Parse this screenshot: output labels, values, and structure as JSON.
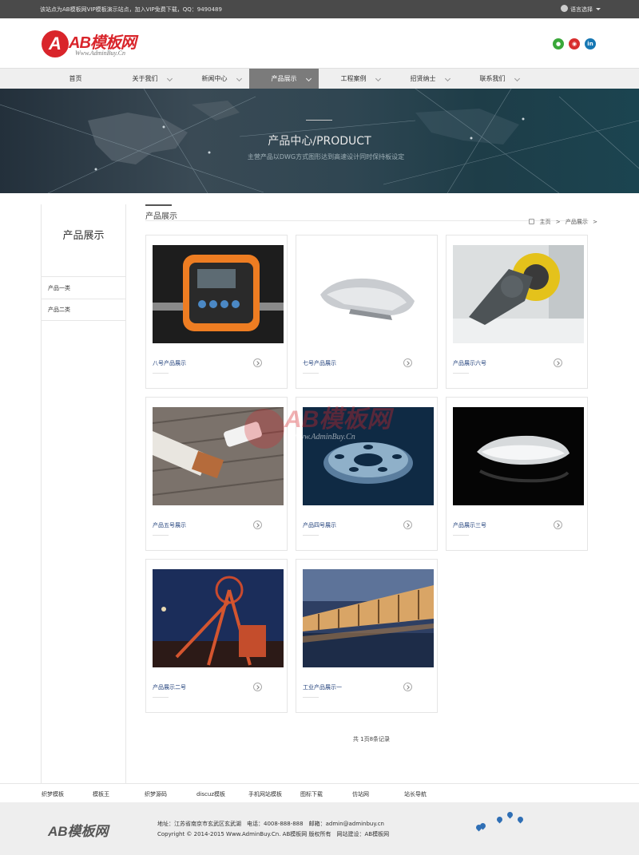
{
  "topbar": {
    "notice": "该站点为AB模板网VIP模板演示站点，加入VIP免费下载，QQ：9490489",
    "language": "语言选择"
  },
  "header": {
    "logo_text": "AB模板网",
    "logo_url": "Www.AdminBuy.Cn"
  },
  "nav": {
    "items": [
      {
        "label": "首页"
      },
      {
        "label": "关于我们"
      },
      {
        "label": "新闻中心"
      },
      {
        "label": "产品展示"
      },
      {
        "label": "工程案例"
      },
      {
        "label": "招贤纳士"
      },
      {
        "label": "联系我们"
      }
    ],
    "active_index": 3
  },
  "banner": {
    "title": "产品中心/PRODUCT",
    "subtitle": "主营产品以DWG方式图形达到高速设计同时保持板设定"
  },
  "sidebar": {
    "title": "产品展示",
    "items": [
      {
        "label": "产品一类"
      },
      {
        "label": "产品二类"
      }
    ]
  },
  "main": {
    "title": "产品展示",
    "breadcrumb": {
      "home": "主页",
      "sep": ">",
      "current": "产品展示",
      "trail_sep": ">"
    }
  },
  "products": [
    {
      "caption": "八号产品展示",
      "image": "orange-device"
    },
    {
      "caption": "七号产品展示",
      "image": "silver-gadget"
    },
    {
      "caption": "产品展示六号",
      "image": "yellow-tool"
    },
    {
      "caption": "产品五号展示",
      "image": "wooden-usb"
    },
    {
      "caption": "产品四号展示",
      "image": "metal-gear"
    },
    {
      "caption": "产品展示三号",
      "image": "wireless-mouse"
    },
    {
      "caption": "产品展示二号",
      "image": "industrial-tower"
    },
    {
      "caption": "工业产品展示一",
      "image": "dam-at-dusk"
    }
  ],
  "watermark": {
    "name": "AB模板网",
    "url": "Www.AdminBuy.Cn"
  },
  "pager": {
    "text": "共 1页8条记录"
  },
  "footer_links": [
    {
      "label": "织梦模板"
    },
    {
      "label": "模板王"
    },
    {
      "label": "织梦源码"
    },
    {
      "label": "discuz模板"
    },
    {
      "label": "手机网站模板"
    },
    {
      "label": "图标下载"
    },
    {
      "label": "仿站网"
    },
    {
      "label": "站长导航"
    }
  ],
  "footer": {
    "logo": "AB模板网",
    "address_line": "地址：江苏省南京市玄武区玄武湖　电话：4008-888-888　邮箱：admin@adminbuy.cn",
    "copyright_line": "Copyright © 2014-2015 Www.AdminBuy.Cn. AB模板网 版权所有　网站建设：AB模板网"
  },
  "colors": {
    "brand_red": "#d9252b",
    "nav_active": "#7b7b7b",
    "caption_blue": "#1f3f7a",
    "topbar": "#4a4a4a"
  }
}
